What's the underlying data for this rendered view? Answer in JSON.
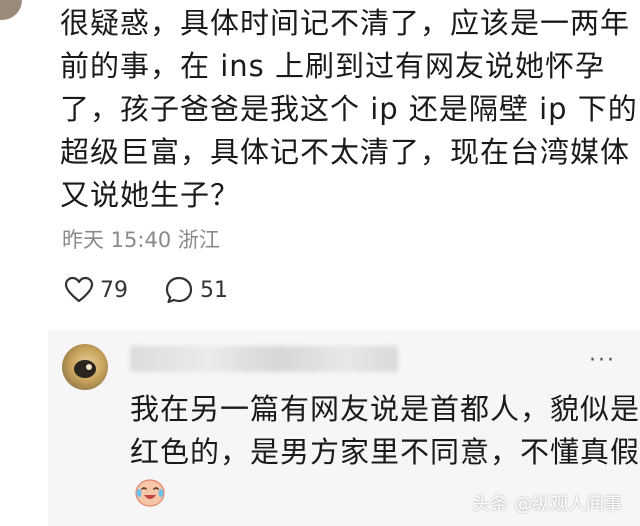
{
  "comment": {
    "lines": [
      "很疑惑，具体时间记不清了，应该是一两年",
      "前的事，在 ins 上刷到过有网友说她怀孕",
      "了，孩子爸爸是我这个 ip 还是隔壁 ip 下的",
      "超级巨富，具体记不太清了，现在台湾媒体",
      "又说她生子？"
    ],
    "meta": "昨天 15:40 浙江",
    "likes": "79",
    "replies": "51"
  },
  "reply": {
    "lines": [
      "我在另一篇有网友说是首都人，貌似是",
      "红色的，是男方家里不同意，不懂真假"
    ],
    "more": "···",
    "emoji_icon": "crying-laughing-face"
  },
  "watermark": "头条 @纵观人间事",
  "colors": {
    "background": "#ffffff",
    "reply_background": "#f6f6f6",
    "meta_text": "#8a8a8a"
  }
}
